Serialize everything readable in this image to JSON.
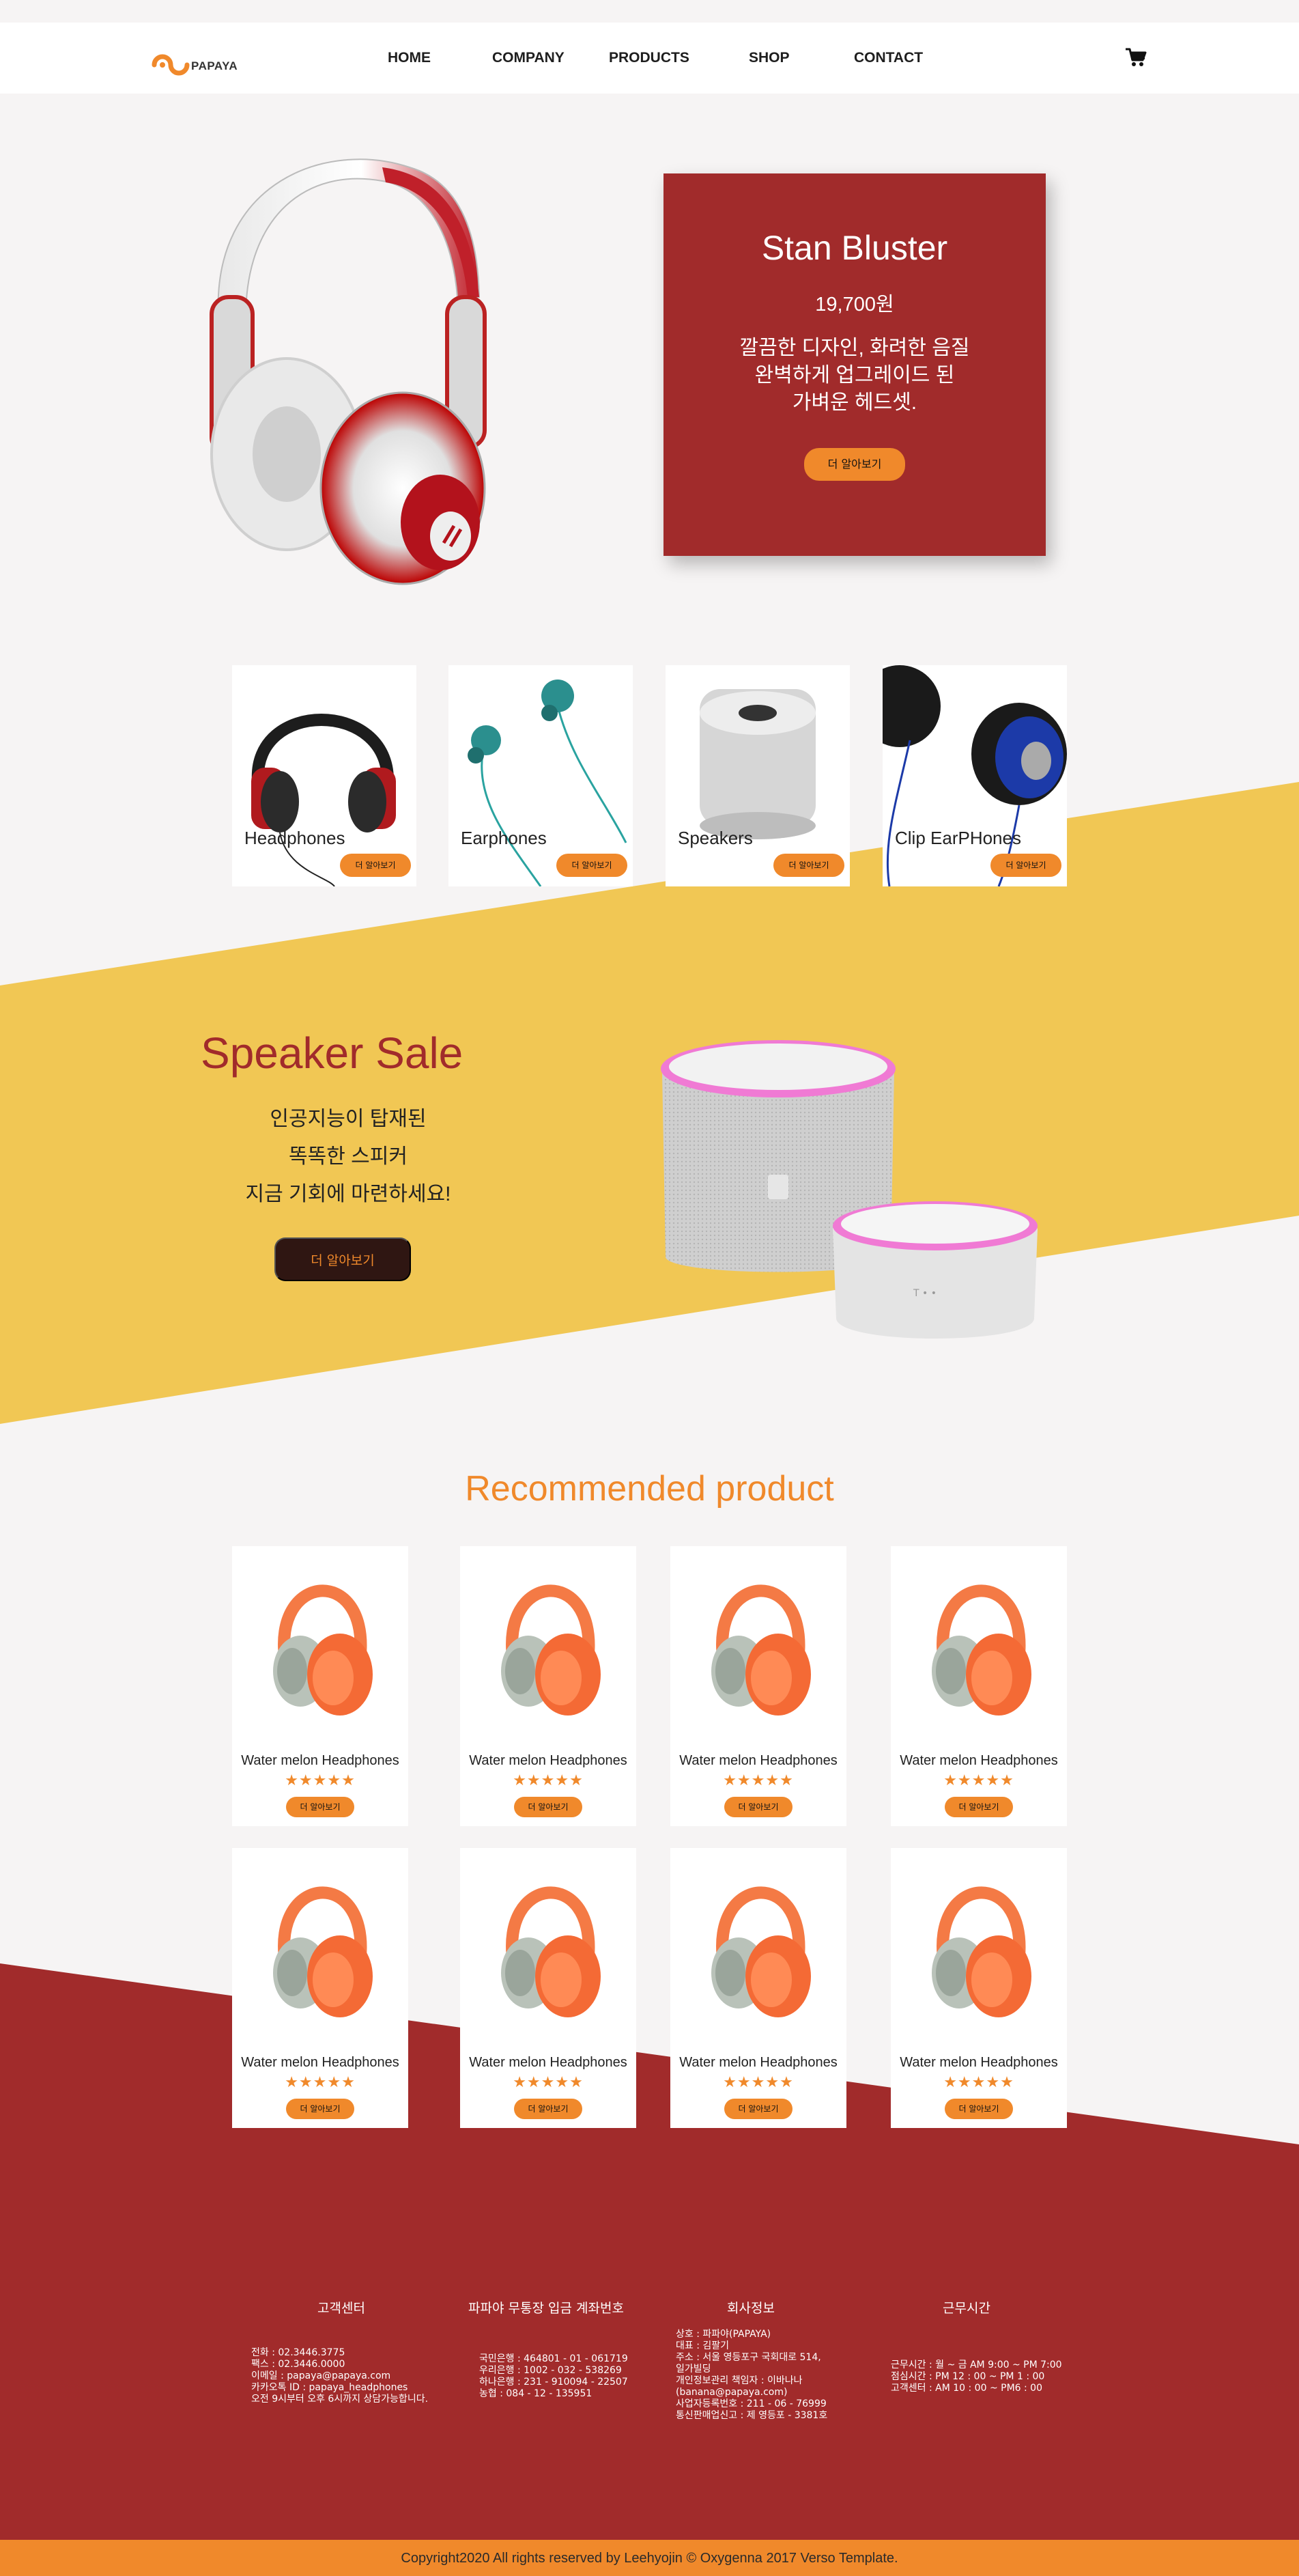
{
  "header": {
    "logo_text": "PAPAYA",
    "nav": [
      "HOME",
      "COMPANY",
      "PRODUCTS",
      "SHOP",
      "CONTACT"
    ],
    "cart_icon": "shopping-cart-icon"
  },
  "hero": {
    "title": "Stan Bluster",
    "price": "19,700원",
    "desc": [
      "깔끔한 디자인, 화려한 음질",
      "완벽하게 업그레이드 된",
      "가벼운 헤드셋."
    ],
    "button": "더 알아보기"
  },
  "categories": [
    {
      "label": "Headphones",
      "button": "더 알아보기"
    },
    {
      "label": "Earphones",
      "button": "더 알아보기"
    },
    {
      "label": "Speakers",
      "button": "더 알아보기"
    },
    {
      "label": "Clip EarPHones",
      "button": "더 알아보기"
    }
  ],
  "sale": {
    "title": "Speaker Sale",
    "lines": [
      "인공지능이 탑재된",
      "똑똑한 스피커",
      "지금 기회에 마련하세요!"
    ],
    "button": "더 알아보기"
  },
  "recommended": {
    "title": "Recommended product",
    "products": [
      {
        "name": "Water melon Headphones",
        "stars": "★★★★★",
        "button": "더 알아보기"
      },
      {
        "name": "Water melon Headphones",
        "stars": "★★★★★",
        "button": "더 알아보기"
      },
      {
        "name": "Water melon Headphones",
        "stars": "★★★★★",
        "button": "더 알아보기"
      },
      {
        "name": "Water melon Headphones",
        "stars": "★★★★★",
        "button": "더 알아보기"
      },
      {
        "name": "Water melon Headphones",
        "stars": "★★★★★",
        "button": "더 알아보기"
      },
      {
        "name": "Water melon Headphones",
        "stars": "★★★★★",
        "button": "더 알아보기"
      },
      {
        "name": "Water melon Headphones",
        "stars": "★★★★★",
        "button": "더 알아보기"
      },
      {
        "name": "Water melon Headphones",
        "stars": "★★★★★",
        "button": "더 알아보기"
      }
    ]
  },
  "footer": {
    "columns": [
      {
        "title": "고객센터",
        "body": "전화 : 02.3446.3775\n팩스 : 02.3446.0000\n이메일 : papaya@papaya.com\n카카오톡 ID : papaya_headphones\n오전 9시부터 오후 6시까지 상담가능합니다."
      },
      {
        "title": "파파야 무통장 입금 계좌번호",
        "body": "국민은행 : 464801 - 01 - 061719\n우리은행 : 1002 - 032 - 538269\n하나은행 : 231 - 910094 - 22507\n농협 : 084 - 12 - 135951"
      },
      {
        "title": "회사정보",
        "body": "상호 : 파파야(PAPAYA)\n대표 : 김팔기\n주소 : 서울 영등포구 국회대로 514,\n          일가빌딩\n개인정보관리 책임자 : 이바나나\n(banana@papaya.com)\n사업자등록번호 : 211 - 06 - 76999\n통신판매업신고 : 제 영등포 - 3381호"
      },
      {
        "title": "근무시간",
        "body": "근무시간 : 월 ~ 금 AM 9:00 ~ PM 7:00\n점심시간 : PM 12 : 00 ~ PM 1 : 00\n고객센터 : AM 10 : 00 ~ PM6 : 00"
      }
    ],
    "copyright": "Copyright2020 All rights reserved by Leehyojin © Oxygenna 2017 Verso Template."
  },
  "colors": {
    "brand_red": "#a12b2b",
    "brand_orange": "#f0892b",
    "band_yellow": "#f1c754",
    "background": "#f6f4f4"
  }
}
